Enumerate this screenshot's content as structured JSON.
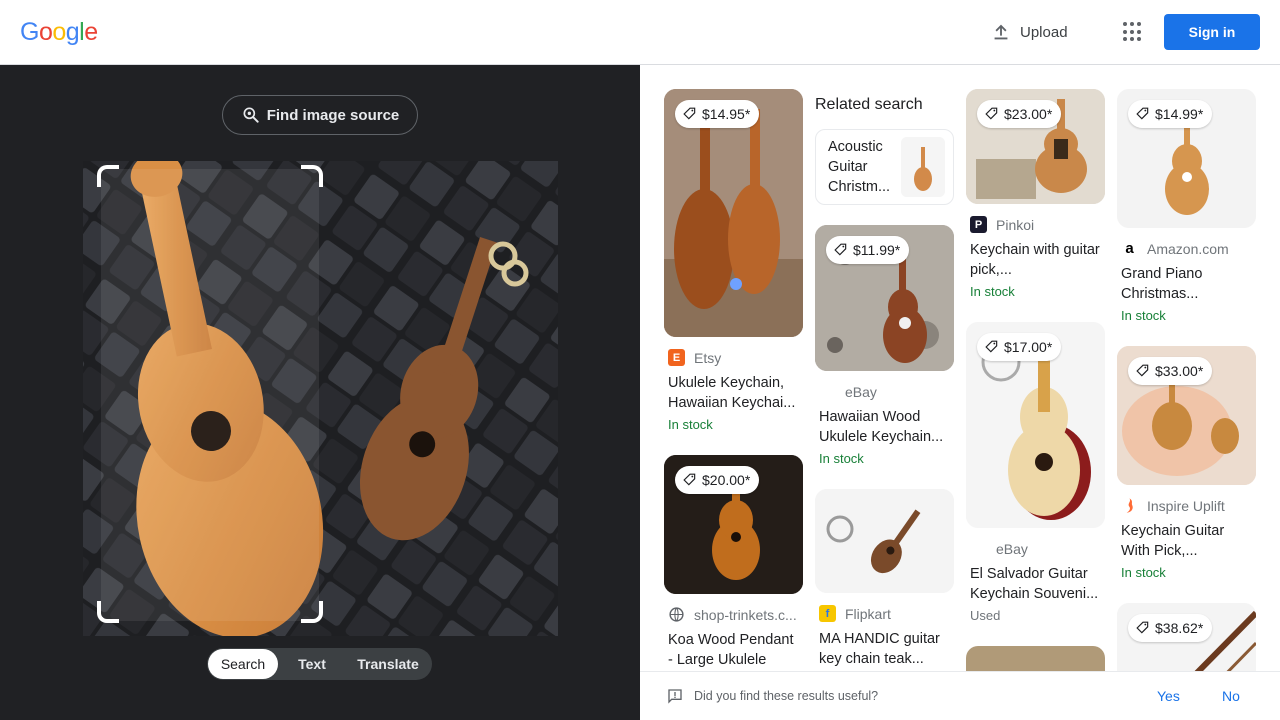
{
  "header": {
    "logo_letters": [
      {
        "ch": "G",
        "color": "#4285F4"
      },
      {
        "ch": "o",
        "color": "#EA4335"
      },
      {
        "ch": "o",
        "color": "#FBBC05"
      },
      {
        "ch": "g",
        "color": "#4285F4"
      },
      {
        "ch": "l",
        "color": "#34A853"
      },
      {
        "ch": "e",
        "color": "#EA4335"
      }
    ],
    "upload_label": "Upload",
    "upload_icon": "upload-icon",
    "apps_icon": "apps-grid-icon",
    "signin_label": "Sign in"
  },
  "left": {
    "find_source_label": "Find image source",
    "find_source_icon": "lens-search-icon",
    "tabs": [
      {
        "label": "Search",
        "active": true
      },
      {
        "label": "Text",
        "active": false
      },
      {
        "label": "Translate",
        "active": false
      }
    ]
  },
  "results": {
    "related_heading": "Related search",
    "related_label": "Acoustic Guitar Christm...",
    "cards": [
      {
        "price": "$14.95*",
        "source": "Etsy",
        "favicon_letter": "E",
        "favicon_color": "#F1641E",
        "title": "Ukulele Keychain, Hawaiian Keychai...",
        "status": "In stock",
        "status_type": "stock"
      },
      {
        "price": "$20.00*",
        "source": "shop-trinkets.c...",
        "favicon_letter": "",
        "favicon_color": "#5f6368",
        "title": "Koa Wood Pendant - Large Ukulele",
        "status": "",
        "status_type": ""
      },
      {
        "price": "$11.99*",
        "source": "eBay",
        "favicon_letter": "",
        "favicon_color": "#e53238",
        "title": "Hawaiian Wood Ukulele Keychain...",
        "status": "In stock",
        "status_type": "stock"
      },
      {
        "price": "",
        "source": "Flipkart",
        "favicon_letter": "f",
        "favicon_color": "#F7C600",
        "title": "MA HANDIC guitar key chain teak...",
        "status": "",
        "status_type": ""
      },
      {
        "price": "$23.00*",
        "source": "Pinkoi",
        "favicon_letter": "P",
        "favicon_color": "#1a1a2e",
        "title": "Keychain with guitar pick,...",
        "status": "In stock",
        "status_type": "stock"
      },
      {
        "price": "$17.00*",
        "source": "eBay",
        "favicon_letter": "",
        "favicon_color": "#e53238",
        "title": "El Salvador Guitar Keychain Souveni...",
        "status": "Used",
        "status_type": "used"
      },
      {
        "price": "$14.99*",
        "source": "Amazon.com",
        "favicon_letter": "a",
        "favicon_color": "#ffffff",
        "title": "Grand Piano Christmas...",
        "status": "In stock",
        "status_type": "stock"
      },
      {
        "price": "$33.00*",
        "source": "Inspire Uplift",
        "favicon_letter": "",
        "favicon_color": "#ff6b35",
        "title": "Keychain Guitar With Pick,...",
        "status": "In stock",
        "status_type": "stock"
      },
      {
        "price": "$38.62*",
        "source": "",
        "favicon_letter": "",
        "favicon_color": "",
        "title": "",
        "status": "",
        "status_type": ""
      }
    ]
  },
  "feedback": {
    "question": "Did you find these results useful?",
    "yes_label": "Yes",
    "no_label": "No",
    "icon": "feedback-icon"
  }
}
